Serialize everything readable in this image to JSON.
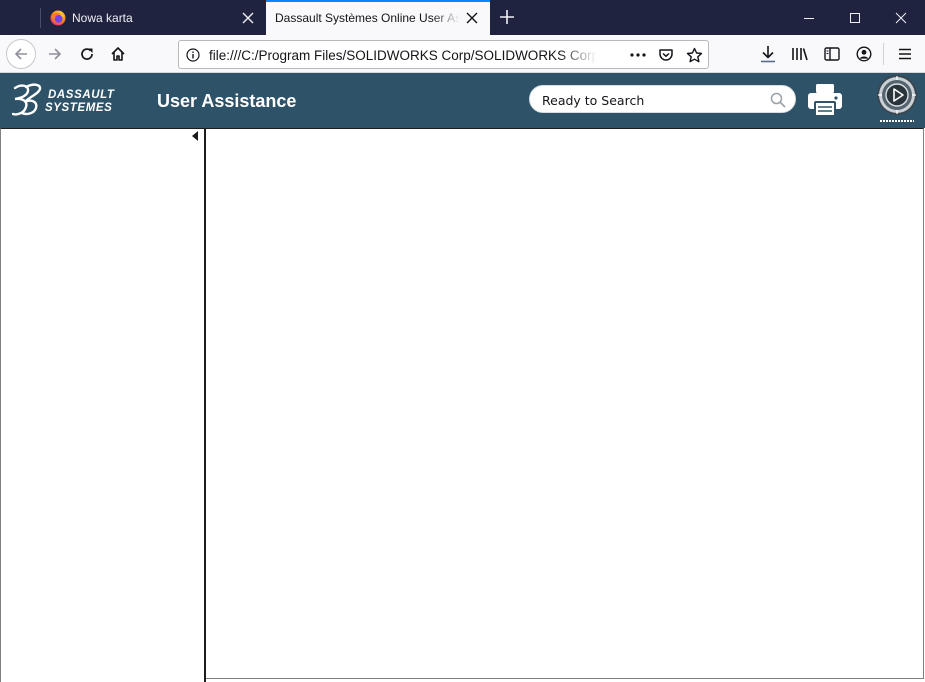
{
  "browser": {
    "tabs": [
      {
        "title": "Nowa karta",
        "active": false,
        "favicon": "firefox-icon"
      },
      {
        "title": "Dassault Systèmes Online User Assistance",
        "active": true,
        "favicon": "none"
      }
    ],
    "new_tab_icon": "plus-icon",
    "window_controls": [
      "minimize-icon",
      "maximize-icon",
      "close-icon"
    ],
    "toolbar": {
      "back_icon": "arrow-left-icon",
      "forward_icon": "arrow-right-icon",
      "reload_icon": "reload-icon",
      "home_icon": "home-icon",
      "url": "file:///C:/Program Files/SOLIDWORKS Corp/SOLIDWORKS Corp/SOLIDWORKS/lang/english/sldworks.chm",
      "page_actions": [
        "info-icon",
        "more-icon",
        "pocket-icon",
        "bookmark-star-icon"
      ],
      "right_icons": [
        "download-icon",
        "library-icon",
        "sidebar-icon",
        "account-icon",
        "hamburger-menu-icon"
      ]
    },
    "colors": {
      "tabstrip": "#202340",
      "accent": "#0a84ff",
      "toolbar": "#f9f9fb"
    }
  },
  "app": {
    "logo": "3ds-dassault-systemes-logo",
    "title": "User Assistance",
    "search": {
      "placeholder": "Ready to Search",
      "value": ""
    },
    "print_icon": "print-icon",
    "experience_logo": "3dexperience-compass-icon",
    "colors": {
      "header": "#2e5267"
    }
  },
  "layout_panels": {
    "left_panel": "table-of-contents",
    "collapse_icon": "triangle-left-icon",
    "content": ""
  }
}
